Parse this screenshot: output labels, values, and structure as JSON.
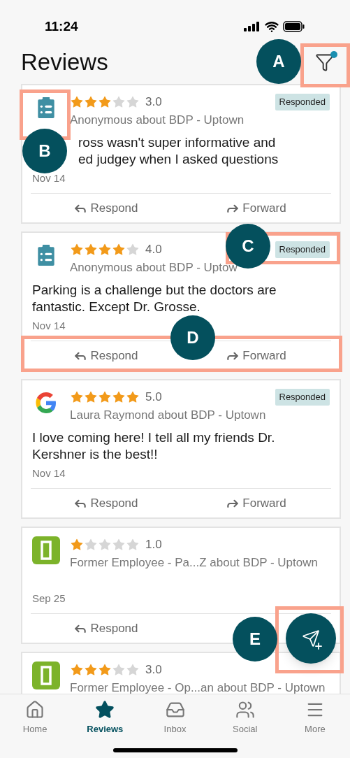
{
  "status_bar": {
    "time": "11:24"
  },
  "header": {
    "title": "Reviews",
    "filter_active": true
  },
  "reviews": [
    {
      "kind": "survey",
      "stars": 3,
      "rating": "3.0",
      "responded": true,
      "badge": "Responded",
      "author": "Anonymous about BDP - Uptown",
      "text_lines": [
        "ross wasn't super informative and",
        "ed judgey when I asked questions"
      ],
      "date": "Nov 14",
      "actions": [
        "Respond",
        "Forward"
      ]
    },
    {
      "kind": "survey",
      "stars": 4,
      "rating": "4.0",
      "responded": true,
      "badge": "Responded",
      "author": "Anonymous about BDP - Uptow",
      "text_lines": [
        "Parking is a challenge but the doctors are",
        "fantastic. Except Dr. Grosse."
      ],
      "date": "Nov 14",
      "actions": [
        "Respond",
        "Forward"
      ]
    },
    {
      "kind": "google",
      "stars": 5,
      "rating": "5.0",
      "responded": true,
      "badge": "Responded",
      "author": "Laura Raymond about BDP - Uptown",
      "text_lines": [
        "I love coming here! I tell all my friends Dr.",
        "Kershner is the best!!"
      ],
      "date": "Nov 14",
      "actions": [
        "Respond",
        "Forward"
      ]
    },
    {
      "kind": "door",
      "stars": 1,
      "rating": "1.0",
      "responded": false,
      "author": "Former Employee - Pa...Z about BDP - Uptown",
      "date": "Sep 25",
      "actions": [
        "Respond"
      ]
    },
    {
      "kind": "door",
      "stars": 3,
      "rating": "3.0",
      "author": "Former Employee - Op...an about BDP - Uptown"
    }
  ],
  "callouts": [
    {
      "label": "A"
    },
    {
      "label": "B"
    },
    {
      "label": "C"
    },
    {
      "label": "D"
    },
    {
      "label": "E"
    }
  ],
  "tab_bar": [
    {
      "label": "Home",
      "selected": false
    },
    {
      "label": "Reviews",
      "selected": true
    },
    {
      "label": "Inbox",
      "selected": false
    },
    {
      "label": "Social",
      "selected": false
    },
    {
      "label": "More",
      "selected": false
    }
  ]
}
